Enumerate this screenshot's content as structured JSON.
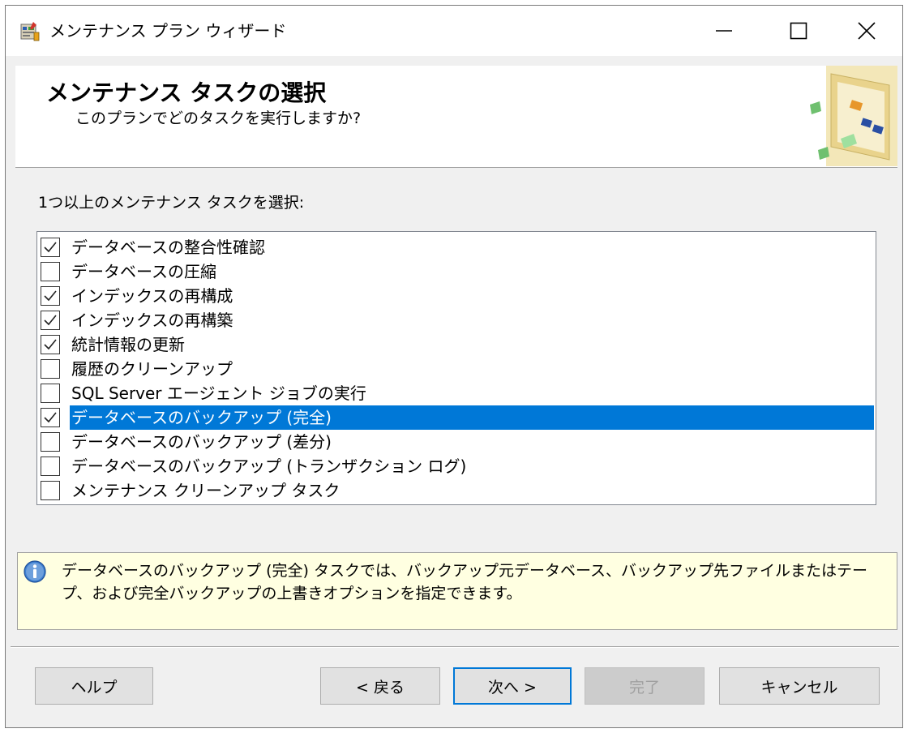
{
  "window": {
    "title": "メンテナンス プラン ウィザード",
    "icons": {
      "app": "wizard-icon",
      "minimize": "minimize-icon",
      "maximize": "maximize-icon",
      "close": "close-icon"
    }
  },
  "header": {
    "title": "メンテナンス タスクの選択",
    "subtitle": "このプランでどのタスクを実行しますか?"
  },
  "prompt": "1つ以上のメンテナンス タスクを選択:",
  "tasks": [
    {
      "label": "データベースの整合性確認",
      "checked": true,
      "selected": false
    },
    {
      "label": "データベースの圧縮",
      "checked": false,
      "selected": false
    },
    {
      "label": "インデックスの再構成",
      "checked": true,
      "selected": false
    },
    {
      "label": "インデックスの再構築",
      "checked": true,
      "selected": false
    },
    {
      "label": "統計情報の更新",
      "checked": true,
      "selected": false
    },
    {
      "label": "履歴のクリーンアップ",
      "checked": false,
      "selected": false
    },
    {
      "label": "SQL Server エージェント ジョブの実行",
      "checked": false,
      "selected": false
    },
    {
      "label": "データベースのバックアップ (完全)",
      "checked": true,
      "selected": true
    },
    {
      "label": "データベースのバックアップ (差分)",
      "checked": false,
      "selected": false
    },
    {
      "label": "データベースのバックアップ (トランザクション ログ)",
      "checked": false,
      "selected": false
    },
    {
      "label": "メンテナンス クリーンアップ タスク",
      "checked": false,
      "selected": false
    }
  ],
  "description": {
    "icon": "info-icon",
    "text": "データベースのバックアップ (完全) タスクでは、バックアップ元データベース、バックアップ先ファイルまたはテープ、および完全バックアップの上書きオプションを指定できます。"
  },
  "buttons": {
    "help": "ヘルプ",
    "back": "< 戻る",
    "next": "次へ >",
    "finish": "完了",
    "cancel": "キャンセル"
  },
  "colors": {
    "selection": "#0078d7",
    "info_background": "#ffffe1",
    "dialog_background": "#f0f0f0"
  }
}
